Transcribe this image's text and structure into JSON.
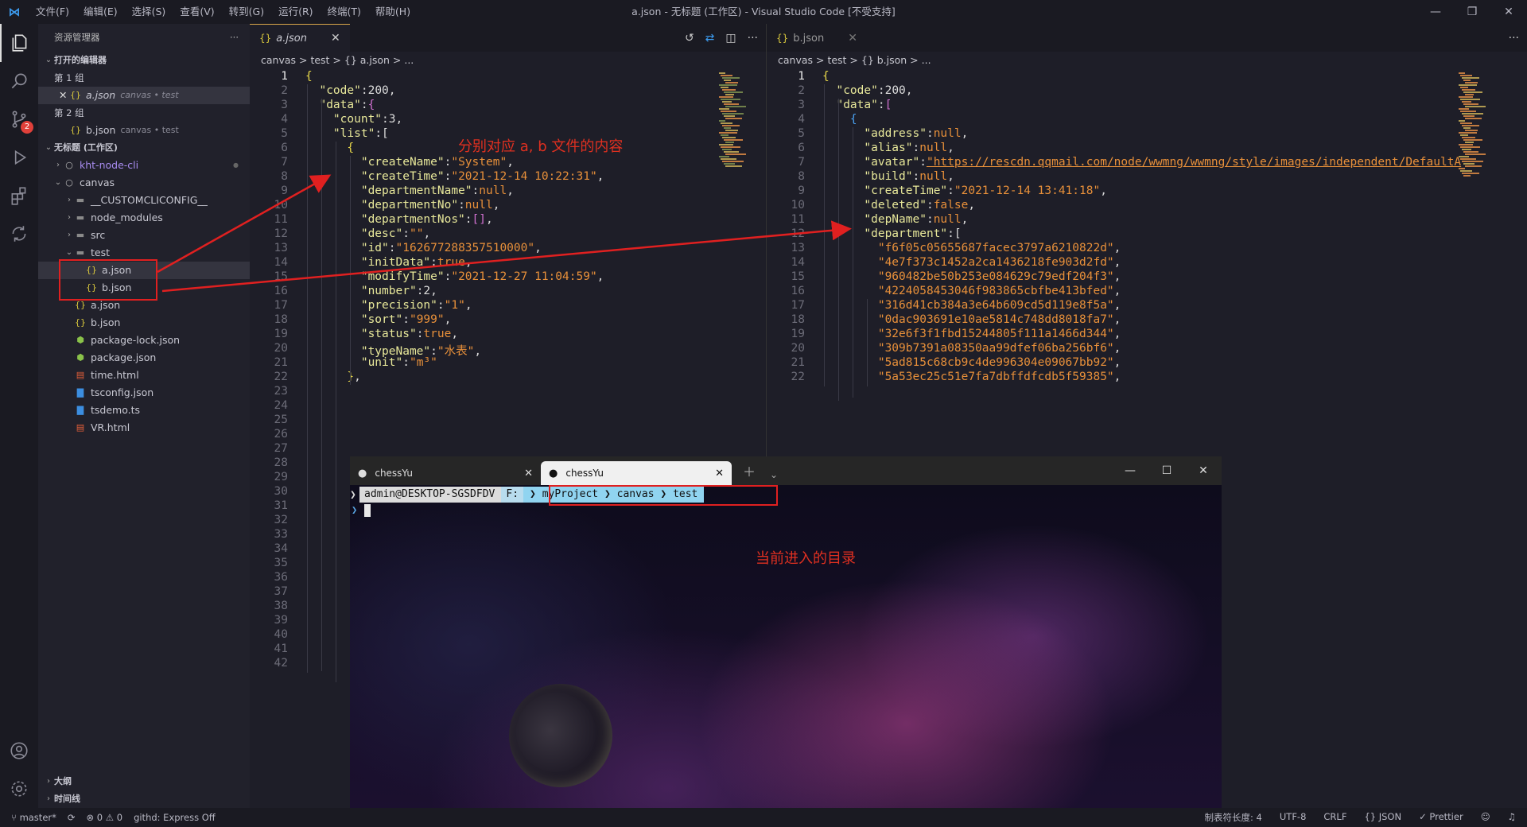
{
  "window": {
    "title": "a.json - 无标题 (工作区) - Visual Studio Code [不受支持]",
    "menu": [
      "文件(F)",
      "编辑(E)",
      "选择(S)",
      "查看(V)",
      "转到(G)",
      "运行(R)",
      "终端(T)",
      "帮助(H)"
    ]
  },
  "activity": {
    "scm_badge": "2"
  },
  "sidebar": {
    "title": "资源管理器",
    "more": "···",
    "open_editors": "打开的编辑器",
    "group1": "第 1 组",
    "group1_file": "a.json",
    "group1_desc": "canvas • test",
    "group2": "第 2 组",
    "group2_file": "b.json",
    "group2_desc": "canvas • test",
    "workspace": "无标题 (工作区)",
    "tree": [
      {
        "label": "kht-node-cli",
        "icon": "○"
      },
      {
        "label": "canvas",
        "icon": "○"
      },
      {
        "label": "__CUSTOMCLICONFIG__",
        "icon": "folder"
      },
      {
        "label": "node_modules",
        "icon": "folder"
      },
      {
        "label": "src",
        "icon": "folder"
      },
      {
        "label": "test",
        "icon": "folder"
      },
      {
        "label": "a.json",
        "icon": "{}"
      },
      {
        "label": "b.json",
        "icon": "{}"
      },
      {
        "label": "a.json",
        "icon": "{}"
      },
      {
        "label": "b.json",
        "icon": "{}"
      },
      {
        "label": "package-lock.json",
        "icon": "pkg"
      },
      {
        "label": "package.json",
        "icon": "pkg"
      },
      {
        "label": "time.html",
        "icon": "html"
      },
      {
        "label": "tsconfig.json",
        "icon": "ts"
      },
      {
        "label": "tsdemo.ts",
        "icon": "ts"
      },
      {
        "label": "VR.html",
        "icon": "html"
      }
    ],
    "outline": "大纲",
    "timeline": "时间线"
  },
  "editorA": {
    "tab": "a.json",
    "crumbs": "canvas > test > {} a.json > ..."
  },
  "editorB": {
    "tab": "b.json",
    "crumbs": "canvas > test > {} b.json > ..."
  },
  "terminal": {
    "tab1": "chessYu",
    "tab2": "chessYu",
    "user": "admin@DESKTOP-SGSDFDV",
    "drive": "F:",
    "path": [
      "myProject",
      "canvas",
      "test"
    ]
  },
  "annotations": {
    "files": "分别对应 a, b 文件的内容",
    "dir": "当前进入的目录"
  },
  "status": {
    "branch": "master*",
    "problems": "⊗ 0 ⚠ 0",
    "githd": "githd: Express Off",
    "tab_size": "制表符长度: 4",
    "encoding": "UTF-8",
    "eol": "CRLF",
    "lang": "{} JSON",
    "prettier": "✓ Prettier"
  },
  "codeA": [
    [
      [
        "b1",
        "{"
      ]
    ],
    [
      [
        "p",
        "  "
      ],
      [
        "k",
        "\"code\""
      ],
      [
        "p",
        ":200,"
      ]
    ],
    [
      [
        "p",
        "  "
      ],
      [
        "k",
        "\"data\""
      ],
      [
        "p",
        ":"
      ],
      [
        "b2",
        "{"
      ]
    ],
    [
      [
        "p",
        "    "
      ],
      [
        "k",
        "\"count\""
      ],
      [
        "p",
        ":3,"
      ]
    ],
    [
      [
        "p",
        "    "
      ],
      [
        "k",
        "\"list\""
      ],
      [
        "p",
        ":["
      ]
    ],
    [
      [
        "p",
        "      "
      ],
      [
        "b1",
        "{"
      ]
    ],
    [
      [
        "p",
        "        "
      ],
      [
        "k",
        "\"createName\""
      ],
      [
        "p",
        ":"
      ],
      [
        "s",
        "\"System\""
      ],
      [
        "p",
        ","
      ]
    ],
    [
      [
        "p",
        "        "
      ],
      [
        "k",
        "\"createTime\""
      ],
      [
        "p",
        ":"
      ],
      [
        "s",
        "\"2021-12-14 10:22:31\""
      ],
      [
        "p",
        ","
      ]
    ],
    [
      [
        "p",
        "        "
      ],
      [
        "k",
        "\"departmentName\""
      ],
      [
        "p",
        ":"
      ],
      [
        "kw",
        "null"
      ],
      [
        "p",
        ","
      ]
    ],
    [
      [
        "p",
        "        "
      ],
      [
        "k",
        "\"departmentNo\""
      ],
      [
        "p",
        ":"
      ],
      [
        "kw",
        "null"
      ],
      [
        "p",
        ","
      ]
    ],
    [
      [
        "p",
        "        "
      ],
      [
        "k",
        "\"departmentNos\""
      ],
      [
        "p",
        ":"
      ],
      [
        "b2",
        "[]"
      ],
      [
        "p",
        ","
      ]
    ],
    [
      [
        "p",
        "        "
      ],
      [
        "k",
        "\"desc\""
      ],
      [
        "p",
        ":"
      ],
      [
        "s",
        "\"\""
      ],
      [
        "p",
        ","
      ]
    ],
    [
      [
        "p",
        "        "
      ],
      [
        "k",
        "\"id\""
      ],
      [
        "p",
        ":"
      ],
      [
        "s",
        "\"162677288357510000\""
      ],
      [
        "p",
        ","
      ]
    ],
    [
      [
        "p",
        "        "
      ],
      [
        "k",
        "\"initData\""
      ],
      [
        "p",
        ":"
      ],
      [
        "kw",
        "true"
      ],
      [
        "p",
        ","
      ]
    ],
    [
      [
        "p",
        "        "
      ],
      [
        "k",
        "\"modifyTime\""
      ],
      [
        "p",
        ":"
      ],
      [
        "s",
        "\"2021-12-27 11:04:59\""
      ],
      [
        "p",
        ","
      ]
    ],
    [
      [
        "p",
        "        "
      ],
      [
        "k",
        "\"number\""
      ],
      [
        "p",
        ":2,"
      ]
    ],
    [
      [
        "p",
        "        "
      ],
      [
        "k",
        "\"precision\""
      ],
      [
        "p",
        ":"
      ],
      [
        "s",
        "\"1\""
      ],
      [
        "p",
        ","
      ]
    ],
    [
      [
        "p",
        "        "
      ],
      [
        "k",
        "\"sort\""
      ],
      [
        "p",
        ":"
      ],
      [
        "s",
        "\"999\""
      ],
      [
        "p",
        ","
      ]
    ],
    [
      [
        "p",
        "        "
      ],
      [
        "k",
        "\"status\""
      ],
      [
        "p",
        ":"
      ],
      [
        "kw",
        "true"
      ],
      [
        "p",
        ","
      ]
    ],
    [
      [
        "p",
        "        "
      ],
      [
        "k",
        "\"typeName\""
      ],
      [
        "p",
        ":"
      ],
      [
        "s",
        "\"水表\""
      ],
      [
        "p",
        ","
      ]
    ],
    [
      [
        "p",
        "        "
      ],
      [
        "k",
        "\"unit\""
      ],
      [
        "p",
        ":"
      ],
      [
        "s",
        "\"m³\""
      ]
    ],
    [
      [
        "p",
        "      "
      ],
      [
        "b1",
        "}"
      ],
      [
        "p",
        ","
      ]
    ]
  ],
  "codeB": [
    [
      [
        "b1",
        "{"
      ]
    ],
    [
      [
        "p",
        "  "
      ],
      [
        "k",
        "\"code\""
      ],
      [
        "p",
        ":200,"
      ]
    ],
    [
      [
        "p",
        "  "
      ],
      [
        "k",
        "\"data\""
      ],
      [
        "p",
        ":"
      ],
      [
        "b2",
        "["
      ]
    ],
    [
      [
        "p",
        "    "
      ],
      [
        "b3",
        "{"
      ]
    ],
    [
      [
        "p",
        "      "
      ],
      [
        "k",
        "\"address\""
      ],
      [
        "p",
        ":"
      ],
      [
        "kw",
        "null"
      ],
      [
        "p",
        ","
      ]
    ],
    [
      [
        "p",
        "      "
      ],
      [
        "k",
        "\"alias\""
      ],
      [
        "p",
        ":"
      ],
      [
        "kw",
        "null"
      ],
      [
        "p",
        ","
      ]
    ],
    [
      [
        "p",
        "      "
      ],
      [
        "k",
        "\"avatar\""
      ],
      [
        "p",
        ":"
      ],
      [
        "url",
        "\"https://rescdn.qqmail.com/node/wwmng/wwmng/style/images/independent/DefaultA"
      ]
    ],
    [
      [
        "p",
        "      "
      ],
      [
        "k",
        "\"build\""
      ],
      [
        "p",
        ":"
      ],
      [
        "kw",
        "null"
      ],
      [
        "p",
        ","
      ]
    ],
    [
      [
        "p",
        "      "
      ],
      [
        "k",
        "\"createTime\""
      ],
      [
        "p",
        ":"
      ],
      [
        "s",
        "\"2021-12-14 13:41:18\""
      ],
      [
        "p",
        ","
      ]
    ],
    [
      [
        "p",
        "      "
      ],
      [
        "k",
        "\"deleted\""
      ],
      [
        "p",
        ":"
      ],
      [
        "kw",
        "false"
      ],
      [
        "p",
        ","
      ]
    ],
    [
      [
        "p",
        "      "
      ],
      [
        "k",
        "\"depName\""
      ],
      [
        "p",
        ":"
      ],
      [
        "kw",
        "null"
      ],
      [
        "p",
        ","
      ]
    ],
    [
      [
        "p",
        "      "
      ],
      [
        "k",
        "\"department\""
      ],
      [
        "p",
        ":["
      ]
    ],
    [
      [
        "p",
        "        "
      ],
      [
        "s",
        "\"f6f05c05655687facec3797a6210822d\""
      ],
      [
        "p",
        ","
      ]
    ],
    [
      [
        "p",
        "        "
      ],
      [
        "s",
        "\"4e7f373c1452a2ca1436218fe903d2fd\""
      ],
      [
        "p",
        ","
      ]
    ],
    [
      [
        "p",
        "        "
      ],
      [
        "s",
        "\"960482be50b253e084629c79edf204f3\""
      ],
      [
        "p",
        ","
      ]
    ],
    [
      [
        "p",
        "        "
      ],
      [
        "s",
        "\"4224058453046f983865cbfbe413bfed\""
      ],
      [
        "p",
        ","
      ]
    ],
    [
      [
        "p",
        "        "
      ],
      [
        "s",
        "\"316d41cb384a3e64b609cd5d119e8f5a\""
      ],
      [
        "p",
        ","
      ]
    ],
    [
      [
        "p",
        "        "
      ],
      [
        "s",
        "\"0dac903691e10ae5814c748dd8018fa7\""
      ],
      [
        "p",
        ","
      ]
    ],
    [
      [
        "p",
        "        "
      ],
      [
        "s",
        "\"32e6f3f1fbd15244805f111a1466d344\""
      ],
      [
        "p",
        ","
      ]
    ],
    [
      [
        "p",
        "        "
      ],
      [
        "s",
        "\"309b7391a08350aa99dfef06ba256bf6\""
      ],
      [
        "p",
        ","
      ]
    ],
    [
      [
        "p",
        "        "
      ],
      [
        "s",
        "\"5ad815c68cb9c4de996304e09067bb92\""
      ],
      [
        "p",
        ","
      ]
    ],
    [
      [
        "p",
        "        "
      ],
      [
        "s",
        "\"5a53ec25c51e7fa7dbffdfcdb5f59385\""
      ],
      [
        "p",
        ","
      ]
    ]
  ],
  "colors": {
    "accent": "#d9a64a",
    "annotation": "#e02020"
  }
}
